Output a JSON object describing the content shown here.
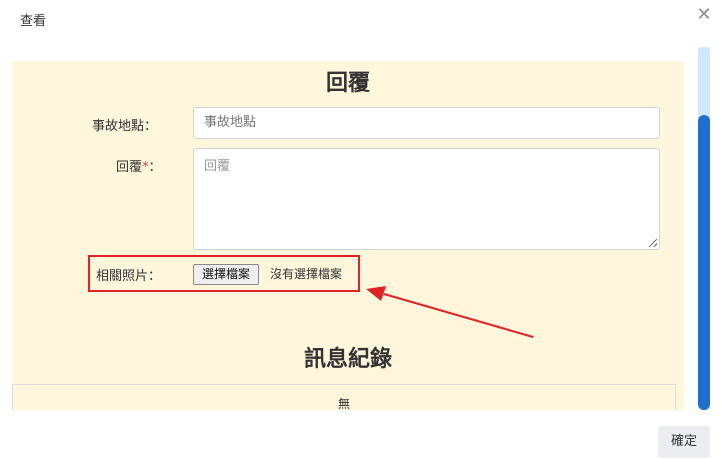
{
  "dialog": {
    "title": "查看",
    "close_icon": "close-icon"
  },
  "reply_section": {
    "heading": "回覆",
    "location": {
      "label": "事故地點：",
      "placeholder": "事故地點",
      "value": ""
    },
    "reply": {
      "label": "回覆",
      "required_mark": "*",
      "label_suffix": "：",
      "placeholder": "回覆",
      "value": ""
    },
    "photos": {
      "label": "相關照片：",
      "button_label": "選擇檔案",
      "status_text": "沒有選擇檔案"
    }
  },
  "log_section": {
    "heading": "訊息紀錄",
    "empty_text": "無"
  },
  "footer": {
    "confirm_label": "確定"
  },
  "annotation": {
    "highlight_color": "#e32323",
    "arrow_color": "#e32323"
  }
}
